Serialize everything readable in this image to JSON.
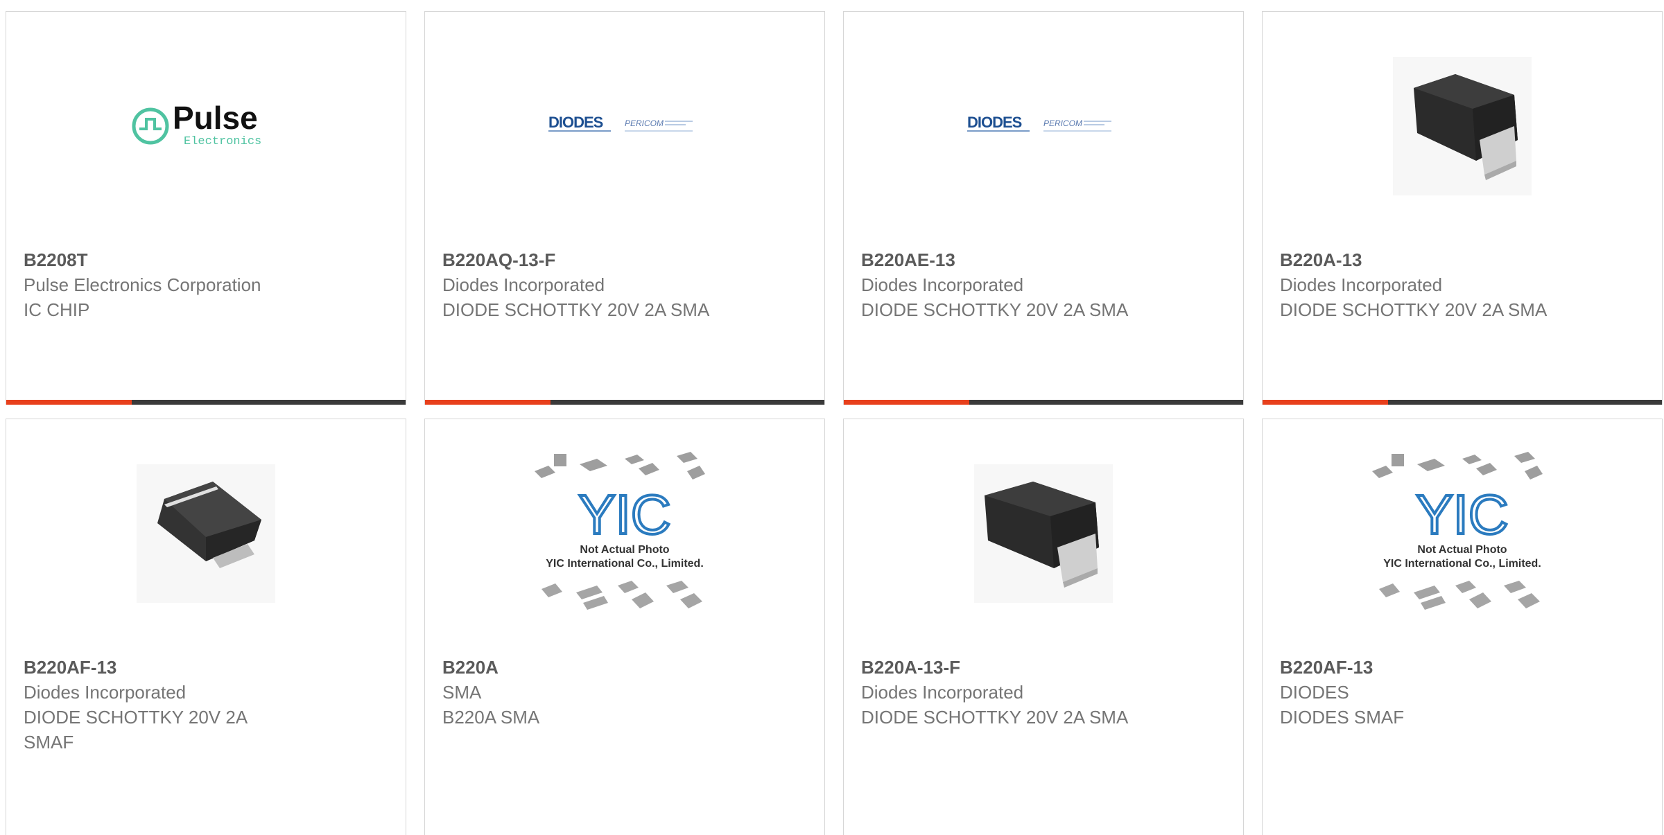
{
  "products": [
    {
      "part": "B2208T",
      "mfr": "Pulse Electronics Corporation",
      "desc": "IC CHIP",
      "image": "pulse-logo",
      "logo_text": "Pulse",
      "logo_sub": "Electronics"
    },
    {
      "part": "B220AQ-13-F",
      "mfr": "Diodes Incorporated",
      "desc": "DIODE SCHOTTKY 20V 2A SMA",
      "image": "diodes-logo",
      "logo_text": "DIODES",
      "logo_sub": "PERICOM"
    },
    {
      "part": "B220AE-13",
      "mfr": "Diodes Incorporated",
      "desc": "DIODE SCHOTTKY 20V 2A SMA",
      "image": "diodes-logo",
      "logo_text": "DIODES",
      "logo_sub": "PERICOM"
    },
    {
      "part": "B220A-13",
      "mfr": "Diodes Incorporated",
      "desc": "DIODE SCHOTTKY 20V 2A SMA",
      "image": "sma-package"
    },
    {
      "part": "B220AF-13",
      "mfr": "Diodes Incorporated",
      "desc": "DIODE SCHOTTKY 20V 2A SMAF",
      "image": "smaf-package"
    },
    {
      "part": "B220A",
      "mfr": "SMA",
      "desc": "B220A SMA",
      "image": "yic-placeholder",
      "placeholder_line1": "Not Actual Photo",
      "placeholder_line2": "YIC International Co., Limited."
    },
    {
      "part": "B220A-13-F",
      "mfr": "Diodes Incorporated",
      "desc": "DIODE SCHOTTKY 20V 2A SMA",
      "image": "sma-package"
    },
    {
      "part": "B220AF-13",
      "mfr": "DIODES",
      "desc": "DIODES SMAF",
      "image": "yic-placeholder",
      "placeholder_line1": "Not Actual Photo",
      "placeholder_line2": "YIC International Co., Limited."
    }
  ],
  "colors": {
    "accent": "#e8401c",
    "bar": "#3a3a3a",
    "pulse": "#4fc3a1",
    "diodes": "#1d4f91",
    "yic": "#2b7bbf"
  }
}
